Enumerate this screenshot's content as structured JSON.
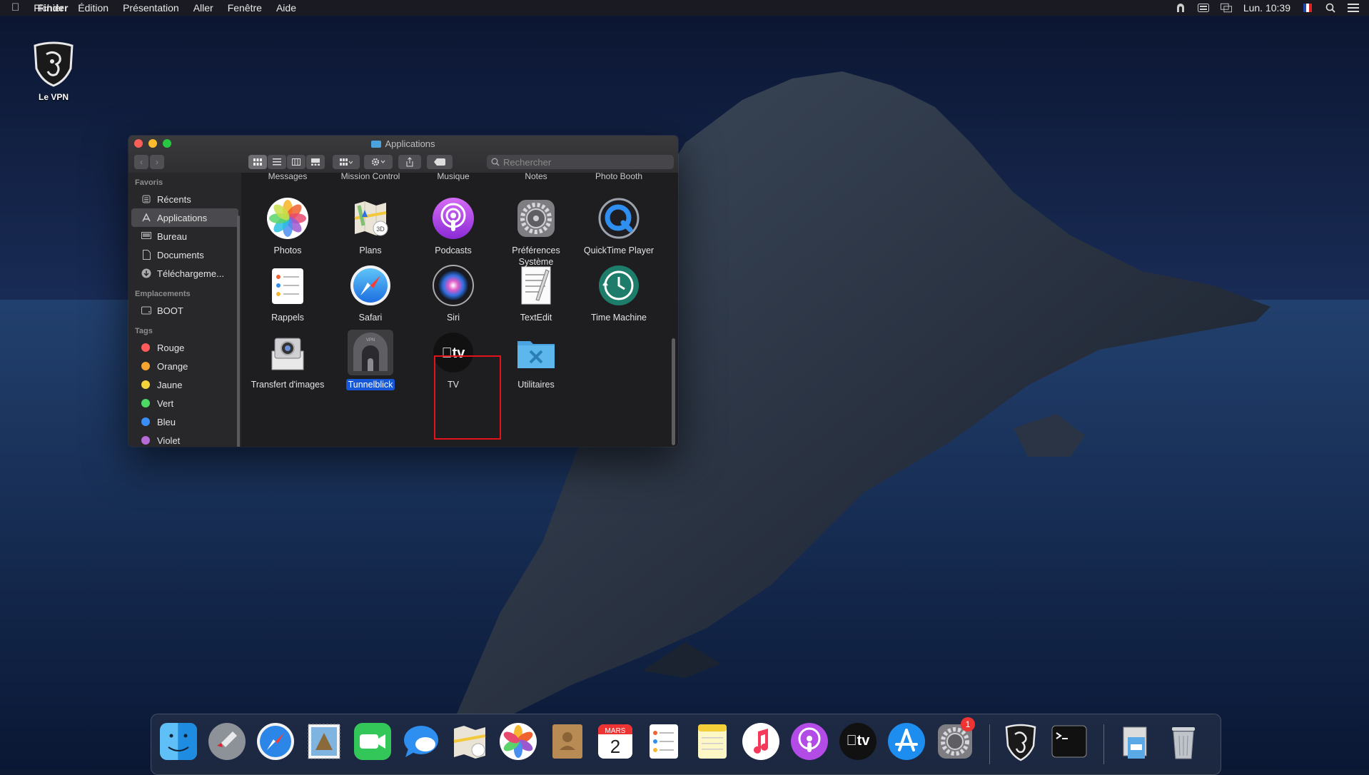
{
  "menubar": {
    "apple_icon": "apple-icon",
    "items": [
      "Finder",
      "Fichier",
      "Édition",
      "Présentation",
      "Aller",
      "Fenêtre",
      "Aide"
    ],
    "clock": "Lun. 10:39"
  },
  "desktop": {
    "vpn_label": "Le VPN"
  },
  "finder": {
    "title": "Applications",
    "search_placeholder": "Rechercher",
    "sidebar": {
      "favorites_header": "Favoris",
      "favorites": [
        "Récents",
        "Applications",
        "Bureau",
        "Documents",
        "Téléchargeme..."
      ],
      "locations_header": "Emplacements",
      "locations": [
        "BOOT"
      ],
      "tags_header": "Tags",
      "tags": [
        {
          "label": "Rouge",
          "color": "#ff5b5b"
        },
        {
          "label": "Orange",
          "color": "#f7a531"
        },
        {
          "label": "Jaune",
          "color": "#f5d33a"
        },
        {
          "label": "Vert",
          "color": "#4cd964"
        },
        {
          "label": "Bleu",
          "color": "#3a8ff7"
        },
        {
          "label": "Violet",
          "color": "#b66bd9"
        }
      ]
    },
    "cut_row": [
      "Messages",
      "Mission Control",
      "Musique",
      "Notes",
      "Photo Booth"
    ],
    "apps": [
      {
        "name": "Photos"
      },
      {
        "name": "Plans"
      },
      {
        "name": "Podcasts"
      },
      {
        "name": "Préférences Système"
      },
      {
        "name": "QuickTime Player"
      },
      {
        "name": "Rappels"
      },
      {
        "name": "Safari"
      },
      {
        "name": "Siri"
      },
      {
        "name": "TextEdit"
      },
      {
        "name": "Time Machine"
      },
      {
        "name": "Transfert d'images"
      },
      {
        "name": "Tunnelblick"
      },
      {
        "name": "TV"
      },
      {
        "name": "Utilitaires"
      }
    ],
    "selected_app": "Tunnelblick"
  },
  "dock": {
    "calendar_month": "MARS",
    "calendar_day": "2",
    "prefs_badge": "1",
    "tv_label": "tv"
  }
}
